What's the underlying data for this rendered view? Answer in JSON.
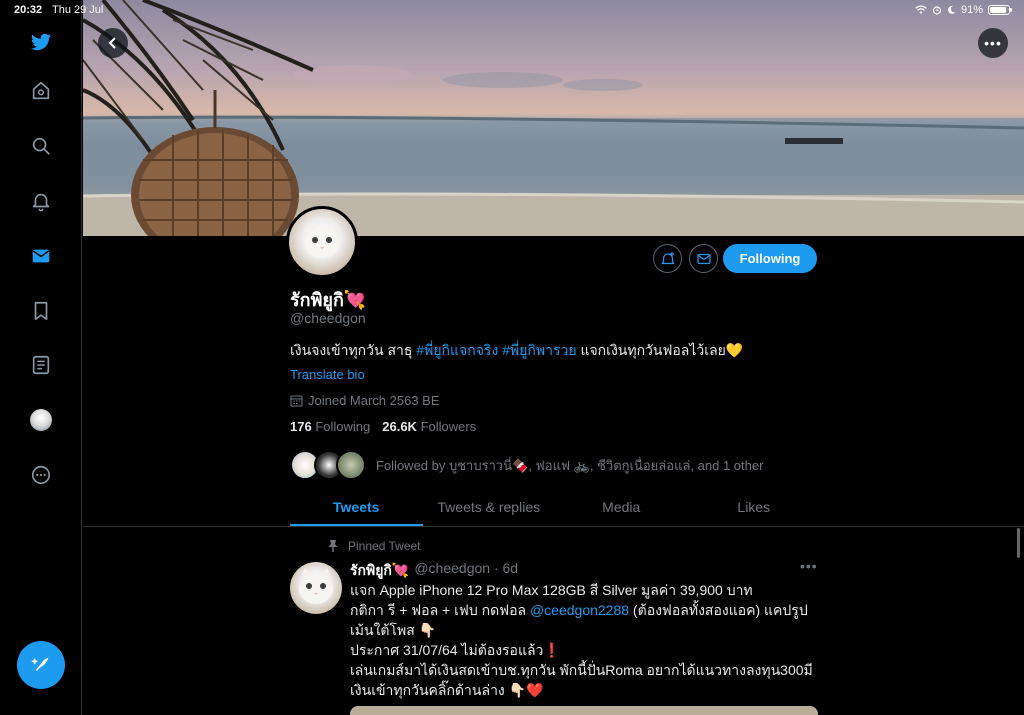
{
  "status_bar": {
    "time": "20:32",
    "date": "Thu 29 Jul",
    "battery": "91%",
    "battery_level": 0.91
  },
  "sidebar": {
    "items": [
      {
        "icon": "twitter-logo-icon",
        "label": ""
      },
      {
        "icon": "home-icon",
        "label": ""
      },
      {
        "icon": "search-icon",
        "label": ""
      },
      {
        "icon": "bell-icon",
        "label": ""
      },
      {
        "icon": "mail-icon",
        "label": ""
      },
      {
        "icon": "bookmark-icon",
        "label": ""
      },
      {
        "icon": "list-icon",
        "label": ""
      },
      {
        "icon": "profile-avatar-icon",
        "label": ""
      },
      {
        "icon": "more-circle-icon",
        "label": ""
      }
    ],
    "accent": "#1d9bf0"
  },
  "profile": {
    "name": "รักพิยูกิ💘",
    "handle": "@cheedgon",
    "bio_text": "เงินจงเข้าทุกวัน สาธุ ",
    "bio_tag1": "#พี่ยูกิแจกจริง",
    "bio_tag2": "#พี่ยูกิพารวย",
    "bio_tail": " แจกเงินทุกวันฟอลไว้เลย💛",
    "translate_label": "Translate bio",
    "joined": "Joined March 2563 BE",
    "following_count": "176",
    "following_label": "Following",
    "followers_count": "26.6K",
    "followers_label": "Followers",
    "followed_by": "Followed by บูชาบราวนี่🍫, ฟอแฟ 🚲, ชีวิตกูเนื่อยล่อแล่, and 1 other",
    "follow_button": "Following"
  },
  "tabs": [
    {
      "label": "Tweets",
      "active": true
    },
    {
      "label": "Tweets & replies",
      "active": false
    },
    {
      "label": "Media",
      "active": false
    },
    {
      "label": "Likes",
      "active": false
    }
  ],
  "pinned_tweet": {
    "pinned_label": "Pinned Tweet",
    "author": "รักพิยูกิ💘",
    "handle_time": "@cheedgon · 6d",
    "line1": "แจก Apple iPhone 12 Pro Max 128GB สี Silver มูลค่า 39,900 บาท",
    "line2a": "กติกา รี + ฟอล + เฟบ กดฟอล ",
    "line2_link": "@ceedgon2288",
    "line2b": " (ต้องฟอลทั้งสองแอค) แคปรูป",
    "line3": "เม้นใต้โพส 👇🏻",
    "line4": "ประกาศ 31/07/64 ไม่ต้องรอแล้ว❗️",
    "line5": "เล่นเกมส์มาได้เงินสดเข้าบช.ทุกวัน พักนี้ปั่นRoma อยากได้แนวทางลงทุน300มี",
    "line6": "เงินเข้าทุกวันคลิ๊กด้านล่าง 👇🏻❤️"
  }
}
